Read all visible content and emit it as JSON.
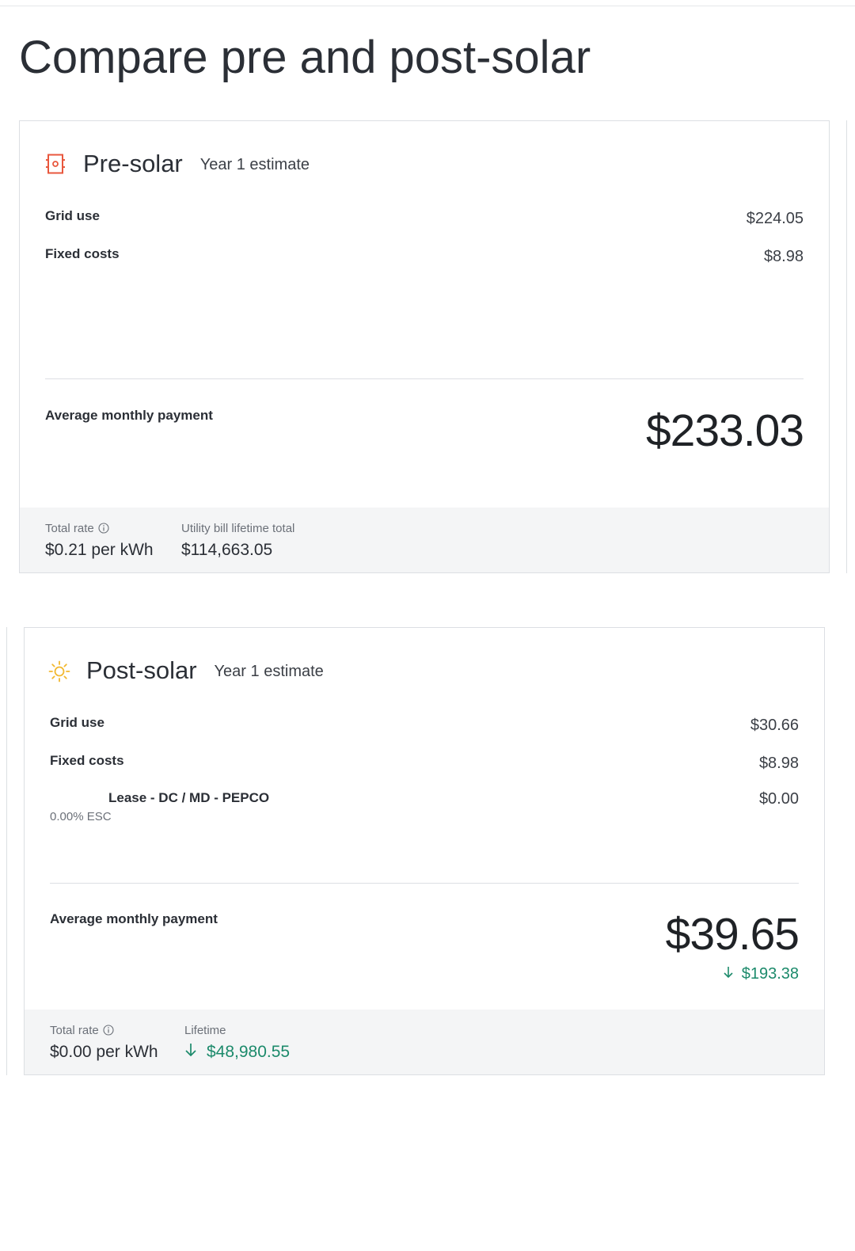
{
  "page": {
    "title": "Compare pre and post-solar"
  },
  "pre_solar": {
    "icon": "utility-meter-icon",
    "title": "Pre-solar",
    "subtitle": "Year 1 estimate",
    "rows": [
      {
        "label": "Grid use",
        "value": "$224.05"
      },
      {
        "label": "Fixed costs",
        "value": "$8.98"
      }
    ],
    "avg_label": "Average monthly payment",
    "avg_value": "$233.03",
    "footer": {
      "rate_label": "Total rate",
      "rate_value": "$0.21 per kWh",
      "lifetime_label": "Utility bill lifetime total",
      "lifetime_value": "$114,663.05"
    },
    "accent": "#e8573d"
  },
  "post_solar": {
    "icon": "sun-icon",
    "title": "Post-solar",
    "subtitle": "Year 1 estimate",
    "rows": [
      {
        "label": "Grid use",
        "value": "$30.66"
      },
      {
        "label": "Fixed costs",
        "value": "$8.98"
      }
    ],
    "lease": {
      "label": "Lease - DC / MD - PEPCO",
      "esc": "0.00% ESC",
      "value": "$0.00"
    },
    "avg_label": "Average monthly payment",
    "avg_value": "$39.65",
    "avg_savings": "$193.38",
    "footer": {
      "rate_label": "Total rate",
      "rate_value": "$0.00 per kWh",
      "lifetime_label": "Lifetime",
      "lifetime_value": "$48,980.55"
    },
    "accent": "#f2b82f",
    "savings_color": "#1c8a6b"
  }
}
